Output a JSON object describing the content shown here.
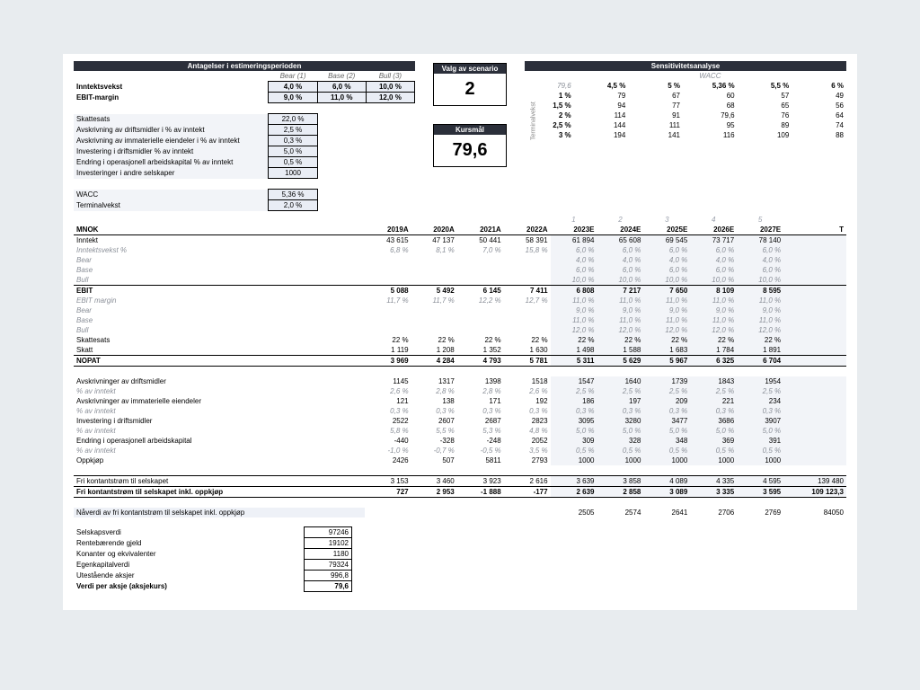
{
  "assumptions": {
    "title": "Antagelser i estimeringsperioden",
    "col_bear": "Bear (1)",
    "col_base": "Base (2)",
    "col_bull": "Bull (3)",
    "rev_growth_lbl": "Inntektsvekst",
    "rev_growth": {
      "bear": "4,0 %",
      "base": "6,0 %",
      "bull": "10,0 %"
    },
    "ebit_margin_lbl": "EBIT-margin",
    "ebit_margin": {
      "bear": "9,0 %",
      "base": "11,0 %",
      "bull": "12,0 %"
    },
    "tax_lbl": "Skattesats",
    "tax": "22,0 %",
    "dep_tang_lbl": "Avskrivning av driftsmidler i % av inntekt",
    "dep_tang": "2,5 %",
    "dep_intang_lbl": "Avskrivning av immaterielle eiendeler i % av inntekt",
    "dep_intang": "0,3 %",
    "capex_lbl": "Investering i driftsmidler % av inntekt",
    "capex": "5,0 %",
    "nwc_lbl": "Endring i operasjonell arbeidskapital % av inntekt",
    "nwc": "0,5 %",
    "acq_lbl": "Investeringer i andre selskaper",
    "acq": "1000",
    "wacc_lbl": "WACC",
    "wacc": "5,36 %",
    "tg_lbl": "Terminalvekst",
    "tg": "2,0 %"
  },
  "scenario": {
    "title": "Valg av scenario",
    "value": "2"
  },
  "target": {
    "title": "Kursmål",
    "value": "79,6"
  },
  "sens": {
    "title": "Sensitivitetsanalyse",
    "wacc_label": "WACC",
    "tg_label": "Terminalvekst",
    "corner": "79,6",
    "wacc_cols": [
      "4,5 %",
      "5 %",
      "5,36 %",
      "5,5 %",
      "6 %"
    ],
    "tg_rows": [
      "1 %",
      "1,5 %",
      "2 %",
      "2,5 %",
      "3 %"
    ],
    "values": [
      [
        "79",
        "67",
        "60",
        "57",
        "49"
      ],
      [
        "94",
        "77",
        "68",
        "65",
        "56"
      ],
      [
        "114",
        "91",
        "79,6",
        "76",
        "64"
      ],
      [
        "144",
        "111",
        "95",
        "89",
        "74"
      ],
      [
        "194",
        "141",
        "116",
        "109",
        "88"
      ]
    ]
  },
  "model": {
    "mnok": "MNOK",
    "years": [
      "2019A",
      "2020A",
      "2021A",
      "2022A",
      "2023E",
      "2024E",
      "2025E",
      "2026E",
      "2027E"
    ],
    "idx": [
      "1",
      "2",
      "3",
      "4",
      "5"
    ],
    "t_label": "T",
    "rows": {
      "rev": {
        "lbl": "Inntekt",
        "v": [
          "43 615",
          "47 137",
          "50 441",
          "58 391",
          "61 894",
          "65 608",
          "69 545",
          "73 717",
          "78 140"
        ]
      },
      "revg": {
        "lbl": "Inntektsvekst %",
        "v": [
          "6,8 %",
          "8,1 %",
          "7,0 %",
          "15,8 %",
          "6,0 %",
          "6,0 %",
          "6,0 %",
          "6,0 %",
          "6,0 %"
        ]
      },
      "revg_bear": {
        "lbl": "Bear",
        "v": [
          "",
          "",
          "",
          "",
          "4,0 %",
          "4,0 %",
          "4,0 %",
          "4,0 %",
          "4,0 %"
        ]
      },
      "revg_base": {
        "lbl": "Base",
        "v": [
          "",
          "",
          "",
          "",
          "6,0 %",
          "6,0 %",
          "6,0 %",
          "6,0 %",
          "6,0 %"
        ]
      },
      "revg_bull": {
        "lbl": "Bull",
        "v": [
          "",
          "",
          "",
          "",
          "10,0 %",
          "10,0 %",
          "10,0 %",
          "10,0 %",
          "10,0 %"
        ]
      },
      "ebit": {
        "lbl": "EBIT",
        "v": [
          "5 088",
          "5 492",
          "6 145",
          "7 411",
          "6 808",
          "7 217",
          "7 650",
          "8 109",
          "8 595"
        ]
      },
      "ebitm": {
        "lbl": "EBIT margin",
        "v": [
          "11,7 %",
          "11,7 %",
          "12,2 %",
          "12,7 %",
          "11,0 %",
          "11,0 %",
          "11,0 %",
          "11,0 %",
          "11,0 %"
        ]
      },
      "ebitm_bear": {
        "lbl": "Bear",
        "v": [
          "",
          "",
          "",
          "",
          "9,0 %",
          "9,0 %",
          "9,0 %",
          "9,0 %",
          "9,0 %"
        ]
      },
      "ebitm_base": {
        "lbl": "Base",
        "v": [
          "",
          "",
          "",
          "",
          "11,0 %",
          "11,0 %",
          "11,0 %",
          "11,0 %",
          "11,0 %"
        ]
      },
      "ebitm_bull": {
        "lbl": "Bull",
        "v": [
          "",
          "",
          "",
          "",
          "12,0 %",
          "12,0 %",
          "12,0 %",
          "12,0 %",
          "12,0 %"
        ]
      },
      "taxr": {
        "lbl": "Skattesats",
        "v": [
          "22 %",
          "22 %",
          "22 %",
          "22 %",
          "22 %",
          "22 %",
          "22 %",
          "22 %",
          "22 %"
        ]
      },
      "tax": {
        "lbl": "Skatt",
        "v": [
          "1 119",
          "1 208",
          "1 352",
          "1 630",
          "1 498",
          "1 588",
          "1 683",
          "1 784",
          "1 891"
        ]
      },
      "nopat": {
        "lbl": "NOPAT",
        "v": [
          "3 969",
          "4 284",
          "4 793",
          "5 781",
          "5 311",
          "5 629",
          "5 967",
          "6 325",
          "6 704"
        ]
      },
      "dep_t": {
        "lbl": "Avskrivninger av driftsmidler",
        "v": [
          "1145",
          "1317",
          "1398",
          "1518",
          "1547",
          "1640",
          "1739",
          "1843",
          "1954"
        ]
      },
      "dep_tp": {
        "lbl": "% av inntekt",
        "v": [
          "2,6 %",
          "2,8 %",
          "2,8 %",
          "2,6 %",
          "2,5 %",
          "2,5 %",
          "2,5 %",
          "2,5 %",
          "2,5 %"
        ]
      },
      "dep_i": {
        "lbl": "Avskrivninger av immaterielle eiendeler",
        "v": [
          "121",
          "138",
          "171",
          "192",
          "186",
          "197",
          "209",
          "221",
          "234"
        ]
      },
      "dep_ip": {
        "lbl": "% av inntekt",
        "v": [
          "0,3 %",
          "0,3 %",
          "0,3 %",
          "0,3 %",
          "0,3 %",
          "0,3 %",
          "0,3 %",
          "0,3 %",
          "0,3 %"
        ]
      },
      "capex": {
        "lbl": "Investering i driftsmidler",
        "v": [
          "2522",
          "2607",
          "2687",
          "2823",
          "3095",
          "3280",
          "3477",
          "3686",
          "3907"
        ]
      },
      "capexp": {
        "lbl": "% av inntekt",
        "v": [
          "5,8 %",
          "5,5 %",
          "5,3 %",
          "4,8 %",
          "5,0 %",
          "5,0 %",
          "5,0 %",
          "5,0 %",
          "5,0 %"
        ]
      },
      "nwc": {
        "lbl": "Endring i operasjonell arbeidskapital",
        "v": [
          "-440",
          "-328",
          "-248",
          "2052",
          "309",
          "328",
          "348",
          "369",
          "391"
        ]
      },
      "nwcp": {
        "lbl": "% av inntekt",
        "v": [
          "-1,0 %",
          "-0,7 %",
          "-0,5 %",
          "3,5 %",
          "0,5 %",
          "0,5 %",
          "0,5 %",
          "0,5 %",
          "0,5 %"
        ]
      },
      "acq": {
        "lbl": "Oppkjøp",
        "v": [
          "2426",
          "507",
          "5811",
          "2793",
          "1000",
          "1000",
          "1000",
          "1000",
          "1000"
        ]
      },
      "fcf": {
        "lbl": "Fri kontantstrøm til selskapet",
        "v": [
          "3 153",
          "3 460",
          "3 923",
          "2 616",
          "3 639",
          "3 858",
          "4 089",
          "4 335",
          "4 595"
        ],
        "t": "139 480"
      },
      "fcfi": {
        "lbl": "Fri kontantstrøm til selskapet inkl. oppkjøp",
        "v": [
          "727",
          "2 953",
          "-1 888",
          "-177",
          "2 639",
          "2 858",
          "3 089",
          "3 335",
          "3 595"
        ],
        "t": "109 123,3"
      },
      "pv": {
        "lbl": "Nåverdi av fri kontantstrøm til selskapet inkl. oppkjøp",
        "v": [
          "",
          "",
          "",
          "",
          "2505",
          "2574",
          "2641",
          "2706",
          "2769"
        ],
        "t": "84050"
      }
    }
  },
  "valuation": {
    "ev_lbl": "Selskapsverdi",
    "ev": "97246",
    "debt_lbl": "Rentebærende gjeld",
    "debt": "19102",
    "cash_lbl": "Konanter og ekvivalenter",
    "cash": "1180",
    "eq_lbl": "Egenkapitalverdi",
    "eq": "79324",
    "shares_lbl": "Utestående aksjer",
    "shares": "996,8",
    "price_lbl": "Verdi per aksje (aksjekurs)",
    "price": "79,6"
  },
  "chart_data": {
    "type": "table",
    "title": "Sensitivitetsanalyse",
    "xlabel": "WACC",
    "ylabel": "Terminalvekst",
    "x": [
      "4,5 %",
      "5 %",
      "5,36 %",
      "5,5 %",
      "6 %"
    ],
    "y": [
      "1 %",
      "1,5 %",
      "2 %",
      "2,5 %",
      "3 %"
    ],
    "values": [
      [
        79,
        67,
        60,
        57,
        49
      ],
      [
        94,
        77,
        68,
        65,
        56
      ],
      [
        114,
        91,
        79.6,
        76,
        64
      ],
      [
        144,
        111,
        95,
        89,
        74
      ],
      [
        194,
        141,
        116,
        109,
        88
      ]
    ]
  }
}
